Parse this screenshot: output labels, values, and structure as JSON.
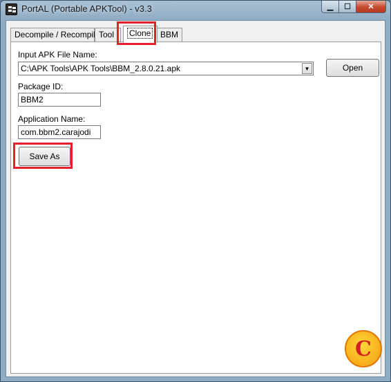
{
  "window": {
    "title": "PortAL (Portable APKTool) - v3.3",
    "caption_buttons": {
      "minimize": "▁",
      "maximize": "☐",
      "close": "✕"
    },
    "icon": "app-icon"
  },
  "tabs": [
    {
      "label": "Decompile / Recompile",
      "active": false
    },
    {
      "label": "Tool",
      "active": false
    },
    {
      "label": "Clone",
      "active": true
    },
    {
      "label": "BBM",
      "active": false
    }
  ],
  "clone_panel": {
    "apk_label": "Input APK File Name:",
    "apk_value": "C:\\APK Tools\\APK Tools\\BBM_2.8.0.21.apk",
    "open_button": "Open",
    "package_label": "Package ID:",
    "package_value": "BBM2",
    "appname_label": "Application Name:",
    "appname_value": "com.bbm2.carajodi",
    "save_button": "Save As"
  },
  "watermark": {
    "letter": "C"
  },
  "colors": {
    "highlight": "#e3202c",
    "close_button": "#c4492e"
  }
}
